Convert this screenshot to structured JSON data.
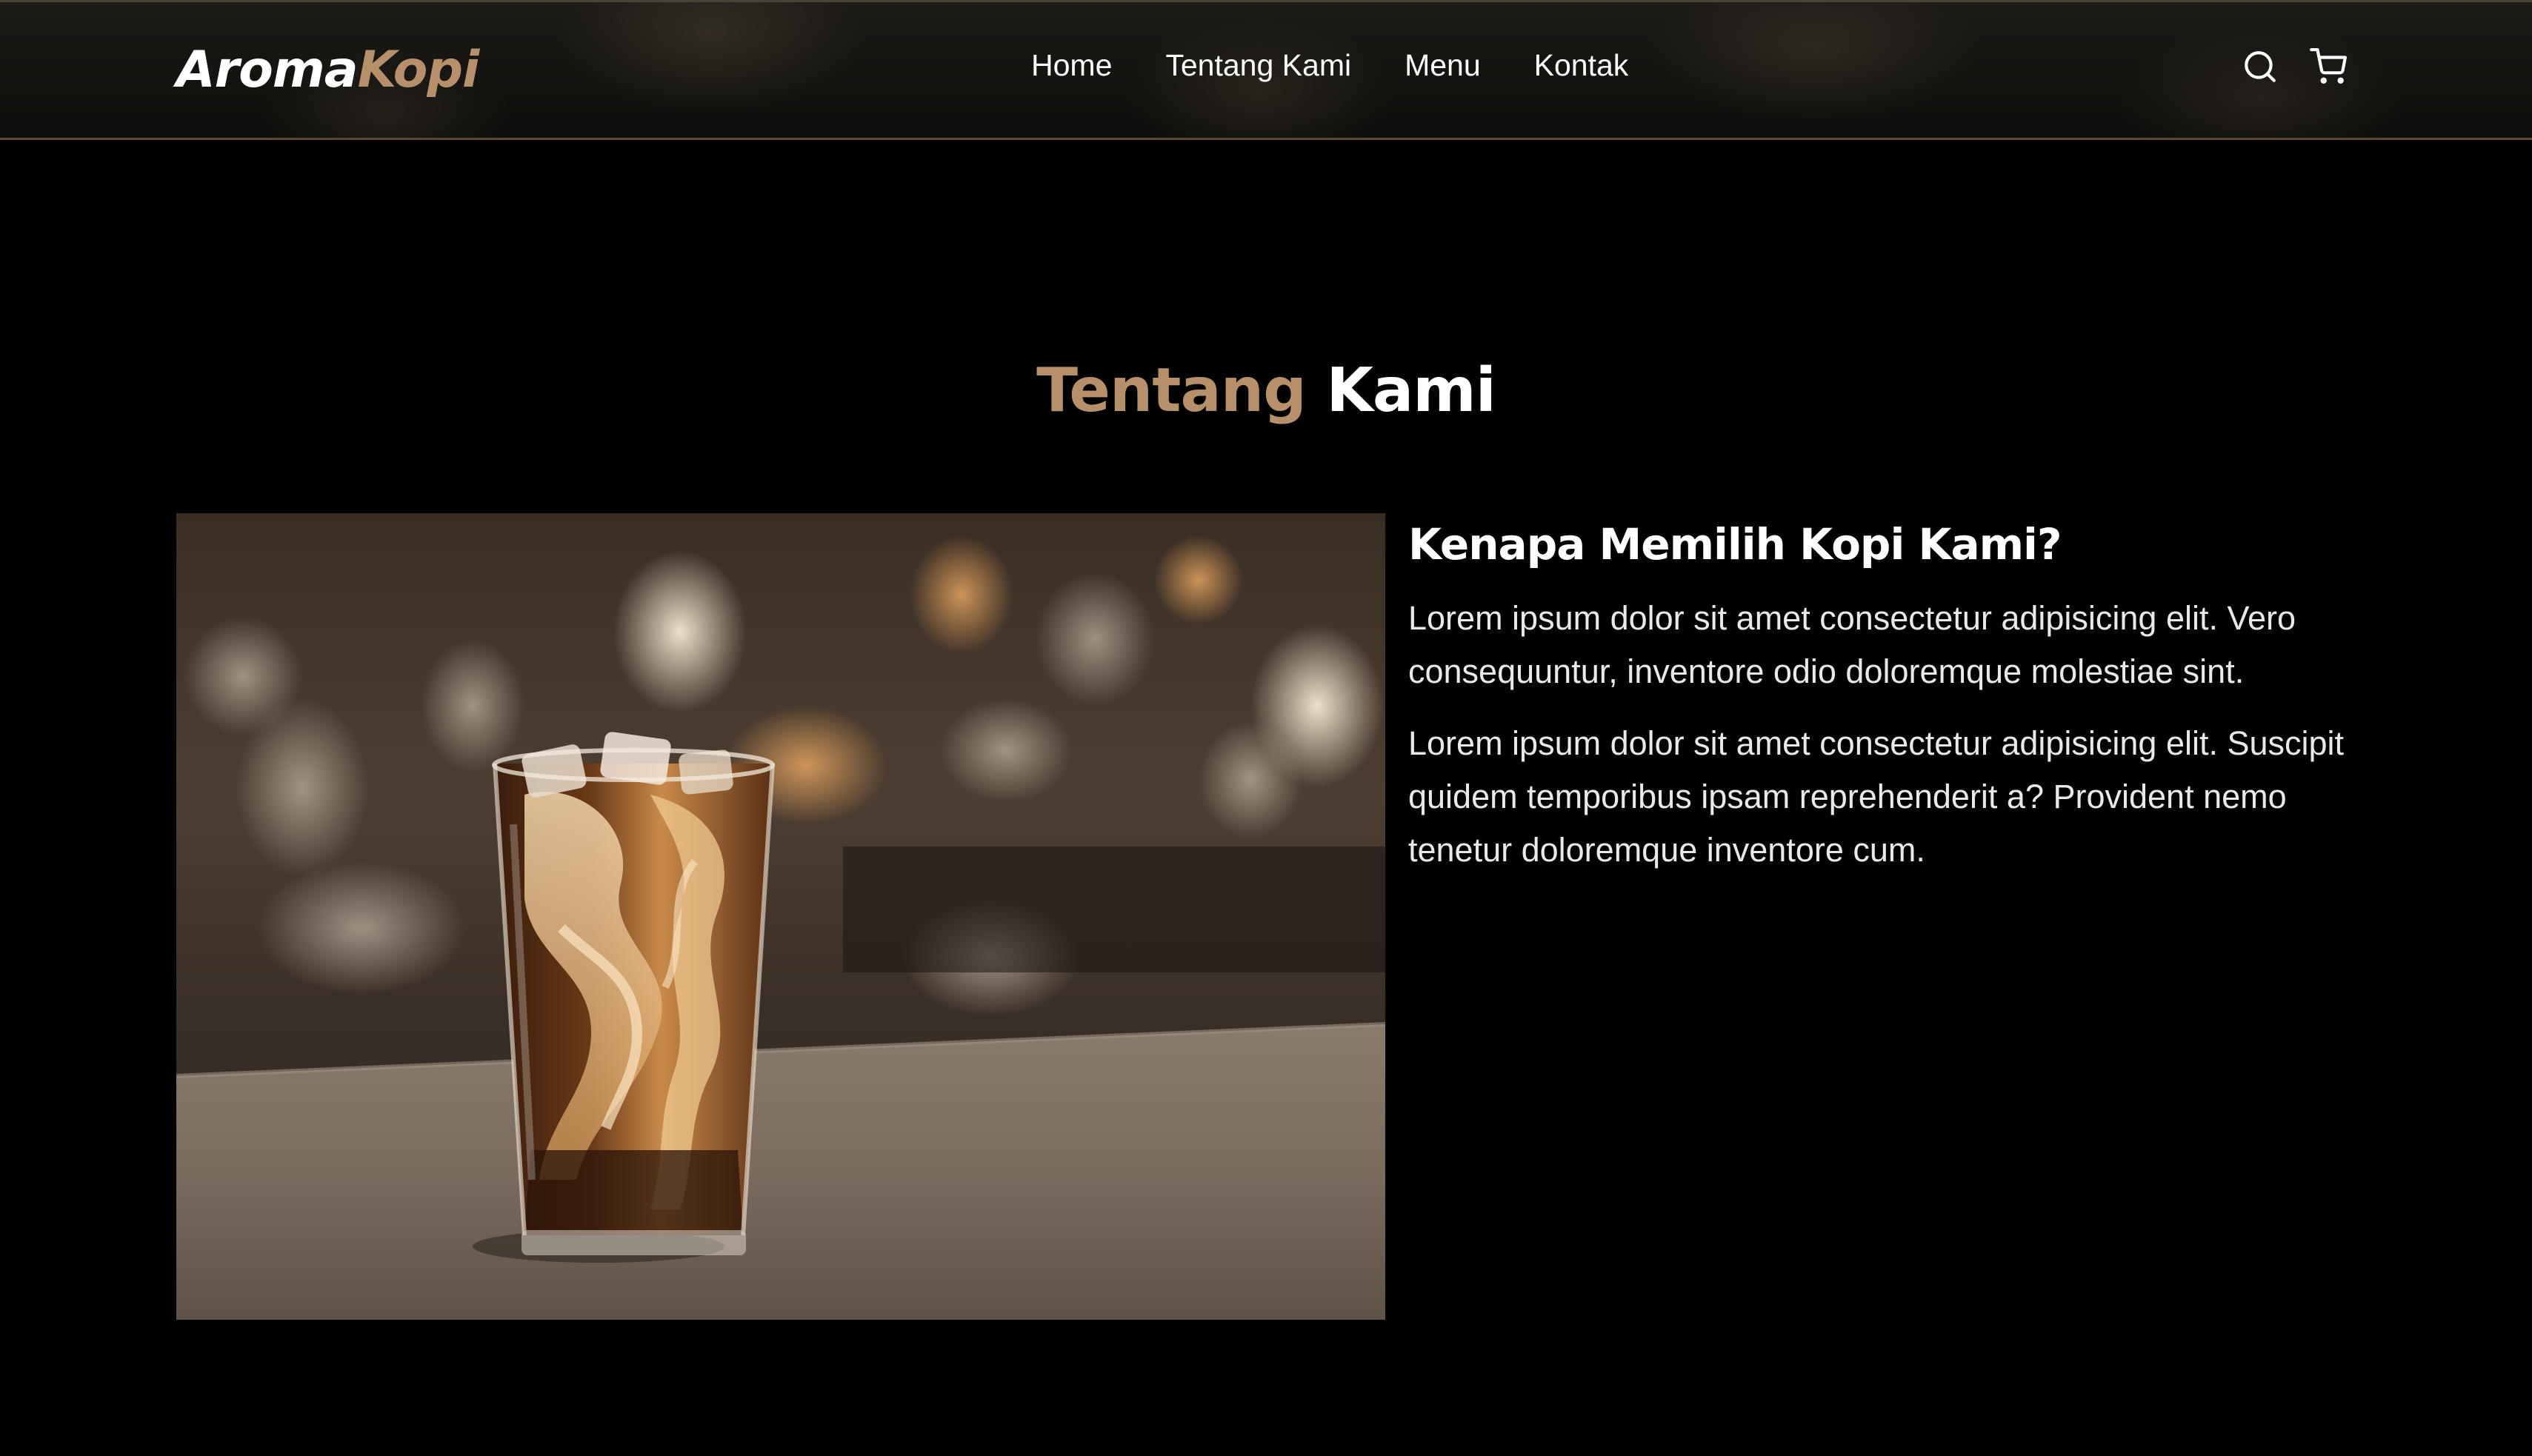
{
  "navbar": {
    "logo_part1": "Aroma",
    "logo_part2": "Kopi",
    "links": [
      "Home",
      "Tentang Kami",
      "Menu",
      "Kontak"
    ],
    "icons": [
      "search-icon",
      "cart-icon"
    ]
  },
  "about": {
    "title_part1": "Tentang",
    "title_part2": "Kami",
    "heading": "Kenapa Memilih Kopi Kami?",
    "paragraphs": [
      "Lorem ipsum dolor sit amet consectetur adipisicing elit. Vero consequuntur, inventore odio doloremque molestiae sint.",
      "Lorem ipsum dolor sit amet consectetur adipisicing elit. Suscipit quidem temporibus ipsam reprehenderit a? Provident nemo tenetur doloremque inventore cum."
    ]
  },
  "colors": {
    "accent": "#b6906a",
    "background": "#010101",
    "text": "#ffffff"
  }
}
